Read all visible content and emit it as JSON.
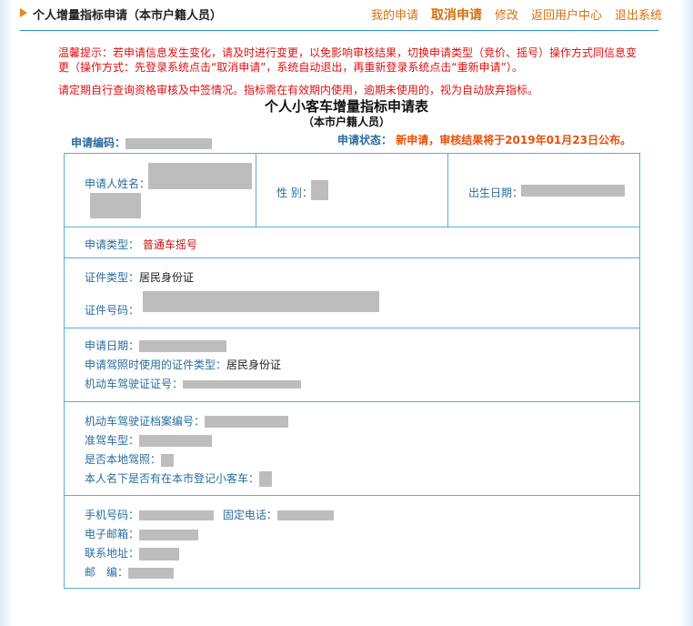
{
  "header": {
    "title": "个人增量指标申请（本市户籍人员）",
    "nav": [
      "我的申请",
      "取消申请",
      "修改",
      "返回用户中心",
      "退出系统"
    ]
  },
  "notices": {
    "tip": "温馨提示：若申请信息发生变化，请及时进行变更，以免影响审核结果，切换申请类型（竞价、摇号）操作方式同信息变更（操作方式：先登录系统点击“取消申请”，系统自动退出，再重新登录系统点击“重新申请”）。",
    "reminder": "请定期自行查询资格审核及中签情况。指标需在有效期内使用，逾期未使用的，视为自动放弃指标。"
  },
  "form": {
    "title": "个人小客车增量指标申请表",
    "subtitle": "（本市户籍人员）",
    "app_no_label": "申请编码：",
    "status_label": "申请状态：",
    "status_value": "新申请，审核结果将于2019年01月23日公布。"
  },
  "fields": {
    "name_label": "申请人姓名：",
    "gender_label": "性 别：",
    "birth_label": "出生日期：",
    "apply_type_label": "申请类型：",
    "apply_type_value": "普通车摇号",
    "id_type_label": "证件类型：",
    "id_type_value": "居民身份证",
    "id_no_label": "证件号码：",
    "apply_date_label": "申请日期：",
    "license_id_type_label": "申请驾照时使用的证件类型：",
    "license_id_type_value": "居民身份证",
    "license_no_label": "机动车驾驶证证号：",
    "license_file_label": "机动车驾驶证档案编号：",
    "vehicle_class_label": "准驾车型：",
    "local_license_label": "是否本地驾照：",
    "has_car_label": "本人名下是否有在本市登记小客车：",
    "mobile_label": "手机号码：",
    "phone_label": "固定电话：",
    "email_label": "电子邮箱：",
    "address_label": "联系地址：",
    "postcode_label": "邮　编："
  }
}
